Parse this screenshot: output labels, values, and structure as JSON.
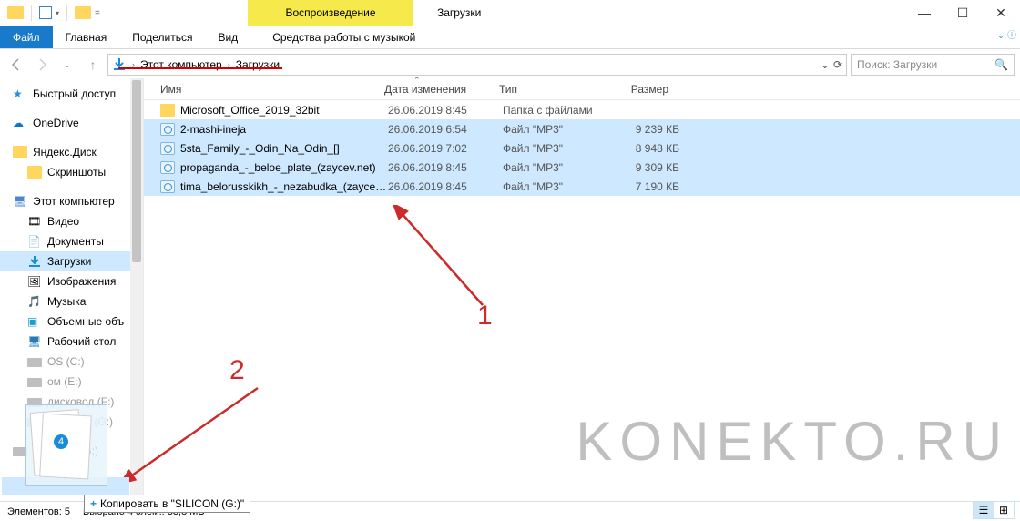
{
  "title_bar": {
    "context_tab": "Воспроизведение",
    "window_title": "Загрузки"
  },
  "ribbon": {
    "file": "Файл",
    "home": "Главная",
    "share": "Поделиться",
    "view": "Вид",
    "music_tools": "Средства работы с музыкой"
  },
  "address": {
    "crumb1": "Этот компьютер",
    "crumb2": "Загрузки"
  },
  "search": {
    "placeholder": "Поиск: Загрузки"
  },
  "tree": {
    "quick_access": "Быстрый доступ",
    "onedrive": "OneDrive",
    "yandex_disk": "Яндекс.Диск",
    "screenshots": "Скриншоты",
    "this_pc": "Этот компьютер",
    "video": "Видео",
    "documents": "Документы",
    "downloads": "Загрузки",
    "images": "Изображения",
    "music": "Музыка",
    "volumes": "Объемные объ",
    "desktop": "Рабочий стол",
    "os_c": "OS (C:)",
    "drive_e": "ом (E:)",
    "dvd_f": "дисковод (F:)",
    "silicon_g_dim": "SILICON (G:)",
    "silicon_g": "SILICON (G:)"
  },
  "columns": {
    "name": "Имя",
    "date": "Дата изменения",
    "type": "Тип",
    "size": "Размер"
  },
  "rows": [
    {
      "name": "Microsoft_Office_2019_32bit",
      "date": "26.06.2019 8:45",
      "type": "Папка с файлами",
      "size": "",
      "kind": "folder",
      "selected": false
    },
    {
      "name": "2-mashi-ineja",
      "date": "26.06.2019 6:54",
      "type": "Файл \"MP3\"",
      "size": "9 239 КБ",
      "kind": "mp3",
      "selected": true
    },
    {
      "name": "5sta_Family_-_Odin_Na_Odin_[]",
      "date": "26.06.2019 7:02",
      "type": "Файл \"MP3\"",
      "size": "8 948 КБ",
      "kind": "mp3",
      "selected": true
    },
    {
      "name": "propaganda_-_beloe_plate_(zaycev.net)",
      "date": "26.06.2019 8:45",
      "type": "Файл \"MP3\"",
      "size": "9 309 КБ",
      "kind": "mp3",
      "selected": true
    },
    {
      "name": "tima_belorusskikh_-_nezabudka_(zaycev....",
      "date": "26.06.2019 8:45",
      "type": "Файл \"MP3\"",
      "size": "7 190 КБ",
      "kind": "mp3",
      "selected": true
    }
  ],
  "drag": {
    "count": "4",
    "tooltip": "Копировать в \"SILICON (G:)\""
  },
  "annot": {
    "n1": "1",
    "n2": "2"
  },
  "watermark": "KONEKTO.RU",
  "status": {
    "elements": "Элементов: 5",
    "selected": "Выбрано 4 элем.: 33,8 МБ"
  }
}
